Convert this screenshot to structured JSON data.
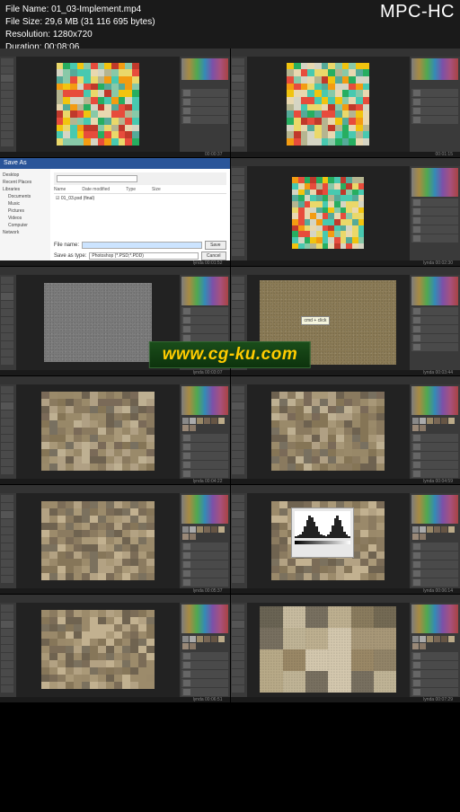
{
  "player": {
    "logo": "MPC-HC"
  },
  "info": {
    "filename_label": "File Name:",
    "filename": "01_03-Implement.mp4",
    "filesize_label": "File Size:",
    "filesize": "29,6 MB (31 116 695 bytes)",
    "resolution_label": "Resolution:",
    "resolution": "1280x720",
    "duration_label": "Duration:",
    "duration": "00:08:06"
  },
  "watermark": "www.cg-ku.com",
  "watermark_small": "lynda",
  "timestamps": [
    "00:00:37",
    "00:01:15",
    "00:01:52",
    "00:02:30",
    "00:03:07",
    "00:03:44",
    "00:04:22",
    "00:04:59",
    "00:05:37",
    "00:06:14",
    "00:06:51",
    "00:07:29"
  ],
  "tooltip": "cmd + click",
  "dialog": {
    "title": "Save As",
    "nav": [
      "Desktop",
      "Recent Places",
      "Libraries",
      "Documents",
      "Music",
      "Pictures",
      "Videos",
      "Computer",
      "Network"
    ],
    "file_item": "01_03.psd (final)",
    "headers": [
      "Name",
      "Date modified",
      "Type",
      "Size"
    ],
    "filename_label": "File name:",
    "filename_value": "",
    "format_label": "Save as type:",
    "format_value": "Photoshop (*.PSD;*.PDD)",
    "save": "Save",
    "cancel": "Cancel"
  },
  "mosaic_colors": [
    "#e74c3c",
    "#f1c40f",
    "#48c9b0",
    "#27ae60",
    "#e8d8b0",
    "#f39c12",
    "#d5d5c4",
    "#55aa99",
    "#c0392b",
    "#ead86a",
    "#88c9a8",
    "#b5b590"
  ],
  "stone_colors": [
    "#8a7a5f",
    "#9a8a6a",
    "#7a6a58",
    "#b0a084",
    "#6e6250",
    "#a89878",
    "#988868",
    "#857556",
    "#beb092",
    "#787060"
  ],
  "patch_colors": [
    "#9a8866",
    "#beb090",
    "#c8bca0",
    "#6a6454",
    "#8a7c5e",
    "#a89878",
    "#787060",
    "#c0b496",
    "#746a54",
    "#b8aa88",
    "#928468",
    "#d4c8ae"
  ],
  "chart_data": {
    "type": "bar",
    "histogram_heights": [
      2,
      3,
      5,
      8,
      14,
      22,
      28,
      26,
      20,
      14,
      8,
      5,
      3,
      2,
      4,
      8,
      16,
      24,
      28,
      22,
      14,
      8,
      4,
      2
    ]
  }
}
